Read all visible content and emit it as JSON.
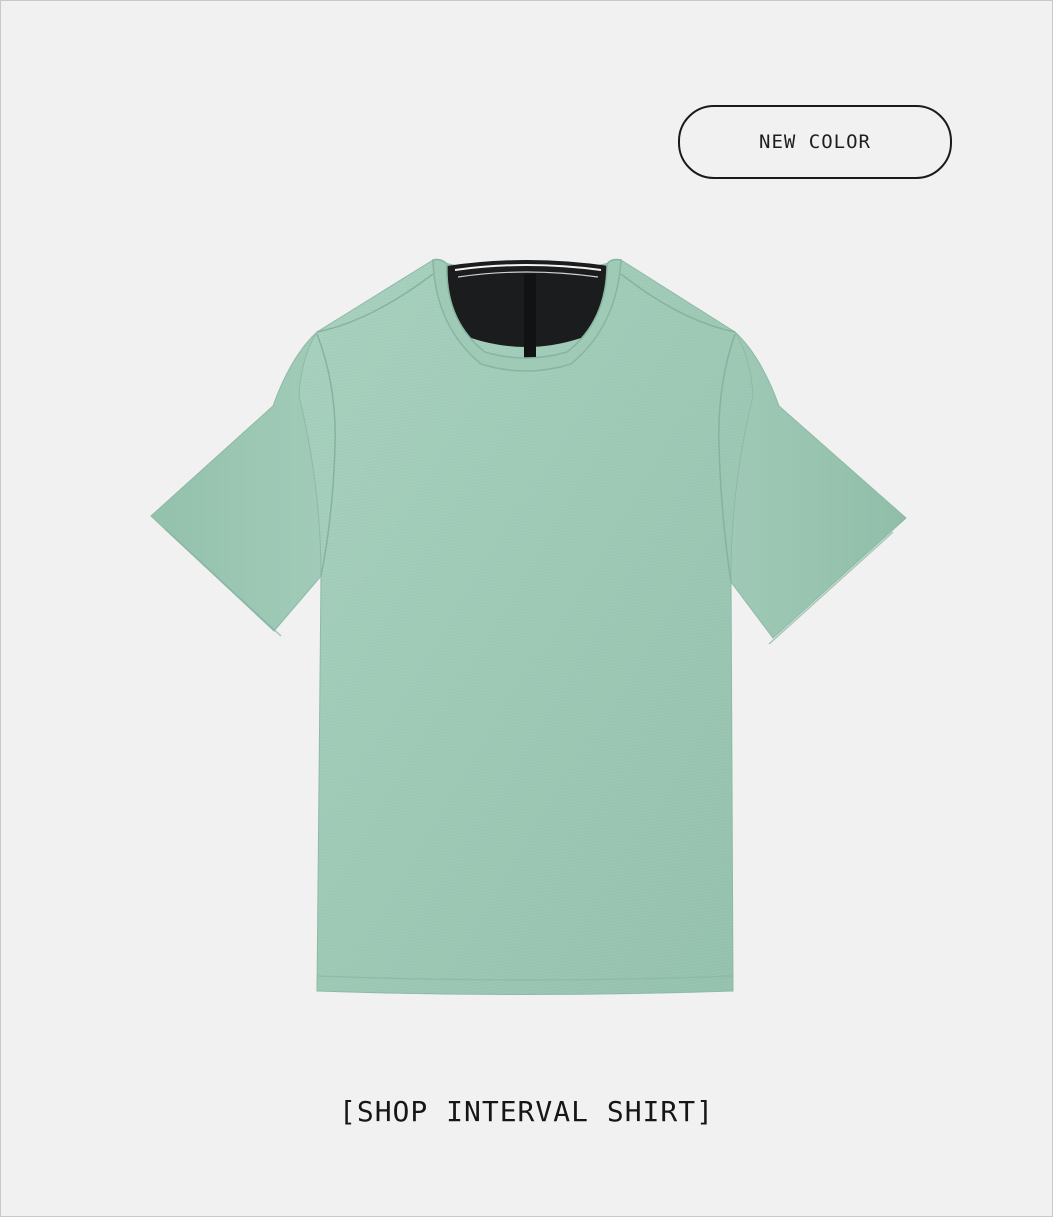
{
  "badge": {
    "label": "NEW COLOR"
  },
  "product": {
    "image_icon": "t-shirt-image",
    "color": "#9cc7b4"
  },
  "cta": {
    "label": "[SHOP INTERVAL SHIRT]"
  }
}
